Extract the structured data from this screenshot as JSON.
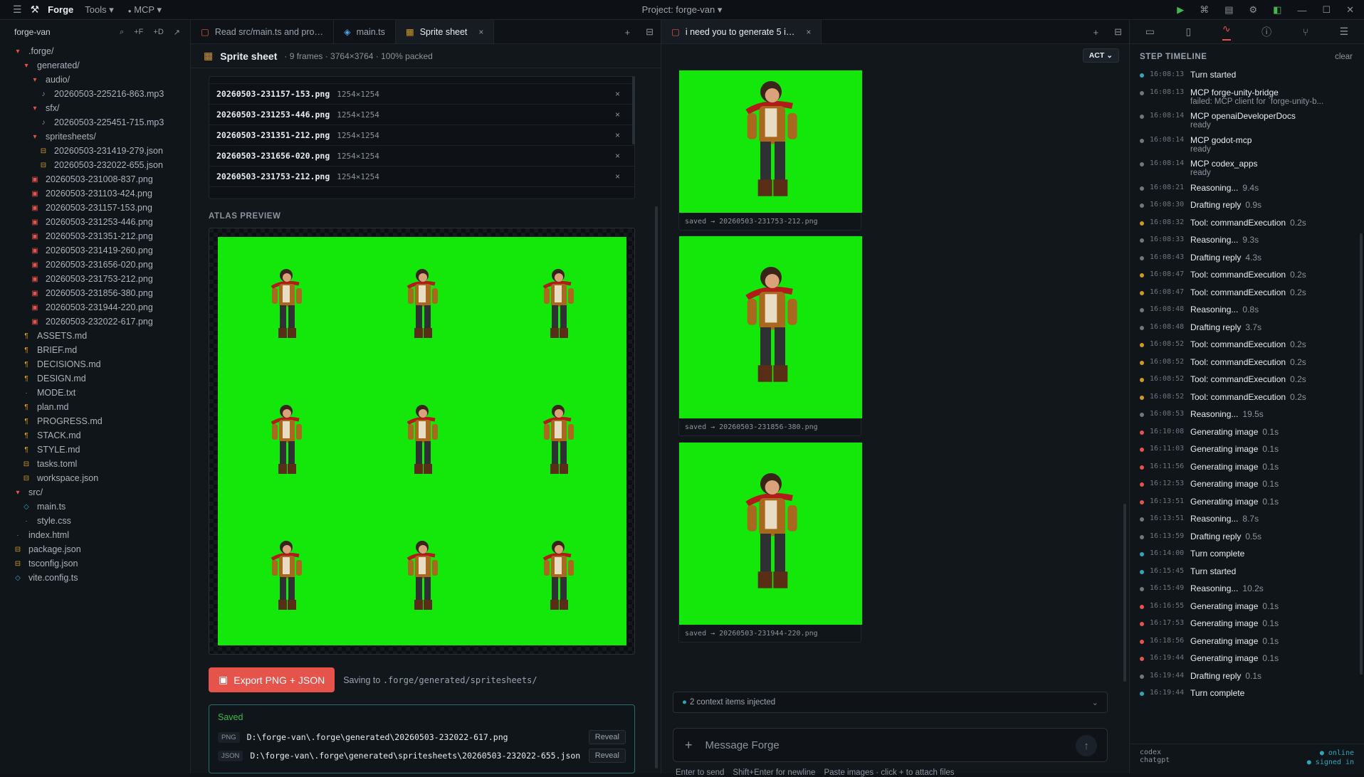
{
  "topbar": {
    "app_name": "Forge",
    "menu_tools": "Tools ▾",
    "menu_mcp": "MCP ▾",
    "project": "Project: forge-van ▾"
  },
  "explorer": {
    "root": "forge-van",
    "actions": [
      "⌕",
      "+F",
      "+D",
      "↗"
    ],
    "tree": [
      {
        "label": ".forge/",
        "depth": 1,
        "kind": "folder"
      },
      {
        "label": "generated/",
        "depth": 2,
        "kind": "folder"
      },
      {
        "label": "audio/",
        "depth": 3,
        "kind": "folder"
      },
      {
        "label": "20260503-225216-863.mp3",
        "depth": 4,
        "kind": "audio"
      },
      {
        "label": "sfx/",
        "depth": 3,
        "kind": "folder"
      },
      {
        "label": "20260503-225451-715.mp3",
        "depth": 4,
        "kind": "audio"
      },
      {
        "label": "spritesheets/",
        "depth": 3,
        "kind": "folder"
      },
      {
        "label": "20260503-231419-279.json",
        "depth": 4,
        "kind": "json"
      },
      {
        "label": "20260503-232022-655.json",
        "depth": 4,
        "kind": "json"
      },
      {
        "label": "20260503-231008-837.png",
        "depth": 3,
        "kind": "png"
      },
      {
        "label": "20260503-231103-424.png",
        "depth": 3,
        "kind": "png"
      },
      {
        "label": "20260503-231157-153.png",
        "depth": 3,
        "kind": "png"
      },
      {
        "label": "20260503-231253-446.png",
        "depth": 3,
        "kind": "png"
      },
      {
        "label": "20260503-231351-212.png",
        "depth": 3,
        "kind": "png"
      },
      {
        "label": "20260503-231419-260.png",
        "depth": 3,
        "kind": "png"
      },
      {
        "label": "20260503-231656-020.png",
        "depth": 3,
        "kind": "png"
      },
      {
        "label": "20260503-231753-212.png",
        "depth": 3,
        "kind": "png"
      },
      {
        "label": "20260503-231856-380.png",
        "depth": 3,
        "kind": "png"
      },
      {
        "label": "20260503-231944-220.png",
        "depth": 3,
        "kind": "png"
      },
      {
        "label": "20260503-232022-617.png",
        "depth": 3,
        "kind": "png"
      },
      {
        "label": "ASSETS.md",
        "depth": 2,
        "kind": "md"
      },
      {
        "label": "BRIEF.md",
        "depth": 2,
        "kind": "md"
      },
      {
        "label": "DECISIONS.md",
        "depth": 2,
        "kind": "md"
      },
      {
        "label": "DESIGN.md",
        "depth": 2,
        "kind": "md"
      },
      {
        "label": "MODE.txt",
        "depth": 2,
        "kind": "txt"
      },
      {
        "label": "plan.md",
        "depth": 2,
        "kind": "md"
      },
      {
        "label": "PROGRESS.md",
        "depth": 2,
        "kind": "md"
      },
      {
        "label": "STACK.md",
        "depth": 2,
        "kind": "md"
      },
      {
        "label": "STYLE.md",
        "depth": 2,
        "kind": "md"
      },
      {
        "label": "tasks.toml",
        "depth": 2,
        "kind": "json"
      },
      {
        "label": "workspace.json",
        "depth": 2,
        "kind": "json"
      },
      {
        "label": "src/",
        "depth": 1,
        "kind": "folder"
      },
      {
        "label": "main.ts",
        "depth": 2,
        "kind": "ts"
      },
      {
        "label": "style.css",
        "depth": 2,
        "kind": "txt"
      },
      {
        "label": "index.html",
        "depth": 1,
        "kind": "html"
      },
      {
        "label": "package.json",
        "depth": 1,
        "kind": "json"
      },
      {
        "label": "tsconfig.json",
        "depth": 1,
        "kind": "json"
      },
      {
        "label": "vite.config.ts",
        "depth": 1,
        "kind": "ts"
      }
    ]
  },
  "middle": {
    "tabs": [
      {
        "label": "Read src/main.ts and pro…",
        "icon": "chat-icon",
        "active": false
      },
      {
        "label": "main.ts",
        "icon": "ts-file-icon",
        "active": false
      },
      {
        "label": "Sprite sheet",
        "icon": "grid-icon",
        "active": true
      }
    ],
    "title": "Sprite sheet",
    "meta": "· 9 frames · 3764×3764 · 100% packed",
    "frames": [
      {
        "name": "20260503-231157-153.png",
        "dim": "1254×1254"
      },
      {
        "name": "20260503-231253-446.png",
        "dim": "1254×1254"
      },
      {
        "name": "20260503-231351-212.png",
        "dim": "1254×1254"
      },
      {
        "name": "20260503-231656-020.png",
        "dim": "1254×1254"
      },
      {
        "name": "20260503-231753-212.png",
        "dim": "1254×1254"
      }
    ],
    "atlas_label": "ATLAS PREVIEW",
    "atlas_bg": "#14e80a",
    "export_label": "Export PNG + JSON",
    "saving_prefix": "Saving to",
    "saving_path": ".forge/generated/spritesheets/",
    "saved_title": "Saved",
    "saved": [
      {
        "badge": "PNG",
        "path": "D:\\forge-van\\.forge\\generated\\20260503-232022-617.png",
        "action": "Reveal"
      },
      {
        "badge": "JSON",
        "path": "D:\\forge-van\\.forge\\generated\\spritesheets\\20260503-232022-655.json",
        "action": "Reveal"
      }
    ]
  },
  "chat": {
    "tab_label": "i need you to generate 5 i…",
    "mode": "ACT ⌄",
    "images": [
      {
        "caption": "saved → 20260503-231753-212.png"
      },
      {
        "caption": "saved → 20260503-231856-380.png"
      },
      {
        "caption": "saved → 20260503-231944-220.png"
      }
    ],
    "context": "2 context items injected",
    "placeholder": "Message Forge",
    "hints": [
      "Enter to send",
      "Shift+Enter for newline",
      "Paste images · click + to attach files"
    ]
  },
  "timeline": {
    "title": "STEP TIMELINE",
    "clear": "clear",
    "colors": {
      "ok": "#3fb950",
      "tool": "#d29922",
      "gen": "#e5534b",
      "think": "#6e7681",
      "done": "#2ea8b8"
    },
    "steps": [
      {
        "time": "16:08:13",
        "label": "Turn started",
        "dur": "",
        "sub": "",
        "kind": "done"
      },
      {
        "time": "16:08:13",
        "label": "MCP forge-unity-bridge",
        "dur": "",
        "sub": "failed: MCP client for `forge-unity-b...",
        "kind": "think"
      },
      {
        "time": "16:08:14",
        "label": "MCP openaiDeveloperDocs",
        "dur": "",
        "sub": "ready",
        "kind": "think"
      },
      {
        "time": "16:08:14",
        "label": "MCP godot-mcp",
        "dur": "",
        "sub": "ready",
        "kind": "think"
      },
      {
        "time": "16:08:14",
        "label": "MCP codex_apps",
        "dur": "",
        "sub": "ready",
        "kind": "think"
      },
      {
        "time": "16:08:21",
        "label": "Reasoning...",
        "dur": "9.4s",
        "sub": "",
        "kind": "think"
      },
      {
        "time": "16:08:30",
        "label": "Drafting reply",
        "dur": "0.9s",
        "sub": "",
        "kind": "think"
      },
      {
        "time": "16:08:32",
        "label": "Tool: commandExecution",
        "dur": "0.2s",
        "sub": "",
        "kind": "tool"
      },
      {
        "time": "16:08:33",
        "label": "Reasoning...",
        "dur": "9.3s",
        "sub": "",
        "kind": "think"
      },
      {
        "time": "16:08:43",
        "label": "Drafting reply",
        "dur": "4.3s",
        "sub": "",
        "kind": "think"
      },
      {
        "time": "16:08:47",
        "label": "Tool: commandExecution",
        "dur": "0.2s",
        "sub": "",
        "kind": "tool"
      },
      {
        "time": "16:08:47",
        "label": "Tool: commandExecution",
        "dur": "0.2s",
        "sub": "",
        "kind": "tool"
      },
      {
        "time": "16:08:48",
        "label": "Reasoning...",
        "dur": "0.8s",
        "sub": "",
        "kind": "think"
      },
      {
        "time": "16:08:48",
        "label": "Drafting reply",
        "dur": "3.7s",
        "sub": "",
        "kind": "think"
      },
      {
        "time": "16:08:52",
        "label": "Tool: commandExecution",
        "dur": "0.2s",
        "sub": "",
        "kind": "tool"
      },
      {
        "time": "16:08:52",
        "label": "Tool: commandExecution",
        "dur": "0.2s",
        "sub": "",
        "kind": "tool"
      },
      {
        "time": "16:08:52",
        "label": "Tool: commandExecution",
        "dur": "0.2s",
        "sub": "",
        "kind": "tool"
      },
      {
        "time": "16:08:52",
        "label": "Tool: commandExecution",
        "dur": "0.2s",
        "sub": "",
        "kind": "tool"
      },
      {
        "time": "16:08:53",
        "label": "Reasoning...",
        "dur": "19.5s",
        "sub": "",
        "kind": "think"
      },
      {
        "time": "16:10:08",
        "label": "Generating image",
        "dur": "0.1s",
        "sub": "",
        "kind": "gen"
      },
      {
        "time": "16:11:03",
        "label": "Generating image",
        "dur": "0.1s",
        "sub": "",
        "kind": "gen"
      },
      {
        "time": "16:11:56",
        "label": "Generating image",
        "dur": "0.1s",
        "sub": "",
        "kind": "gen"
      },
      {
        "time": "16:12:53",
        "label": "Generating image",
        "dur": "0.1s",
        "sub": "",
        "kind": "gen"
      },
      {
        "time": "16:13:51",
        "label": "Generating image",
        "dur": "0.1s",
        "sub": "",
        "kind": "gen"
      },
      {
        "time": "16:13:51",
        "label": "Reasoning...",
        "dur": "8.7s",
        "sub": "",
        "kind": "think"
      },
      {
        "time": "16:13:59",
        "label": "Drafting reply",
        "dur": "0.5s",
        "sub": "",
        "kind": "think"
      },
      {
        "time": "16:14:00",
        "label": "Turn complete",
        "dur": "",
        "sub": "",
        "kind": "done"
      },
      {
        "time": "16:15:45",
        "label": "Turn started",
        "dur": "",
        "sub": "",
        "kind": "done"
      },
      {
        "time": "16:15:49",
        "label": "Reasoning...",
        "dur": "10.2s",
        "sub": "",
        "kind": "think"
      },
      {
        "time": "16:16:55",
        "label": "Generating image",
        "dur": "0.1s",
        "sub": "",
        "kind": "gen"
      },
      {
        "time": "16:17:53",
        "label": "Generating image",
        "dur": "0.1s",
        "sub": "",
        "kind": "gen"
      },
      {
        "time": "16:18:56",
        "label": "Generating image",
        "dur": "0.1s",
        "sub": "",
        "kind": "gen"
      },
      {
        "time": "16:19:44",
        "label": "Generating image",
        "dur": "0.1s",
        "sub": "",
        "kind": "gen"
      },
      {
        "time": "16:19:44",
        "label": "Drafting reply",
        "dur": "0.1s",
        "sub": "",
        "kind": "think"
      },
      {
        "time": "16:19:44",
        "label": "Turn complete",
        "dur": "",
        "sub": "",
        "kind": "done"
      }
    ],
    "footer_left": [
      "codex",
      "chatgpt"
    ],
    "footer_right": [
      "● online",
      "● signed in"
    ]
  }
}
